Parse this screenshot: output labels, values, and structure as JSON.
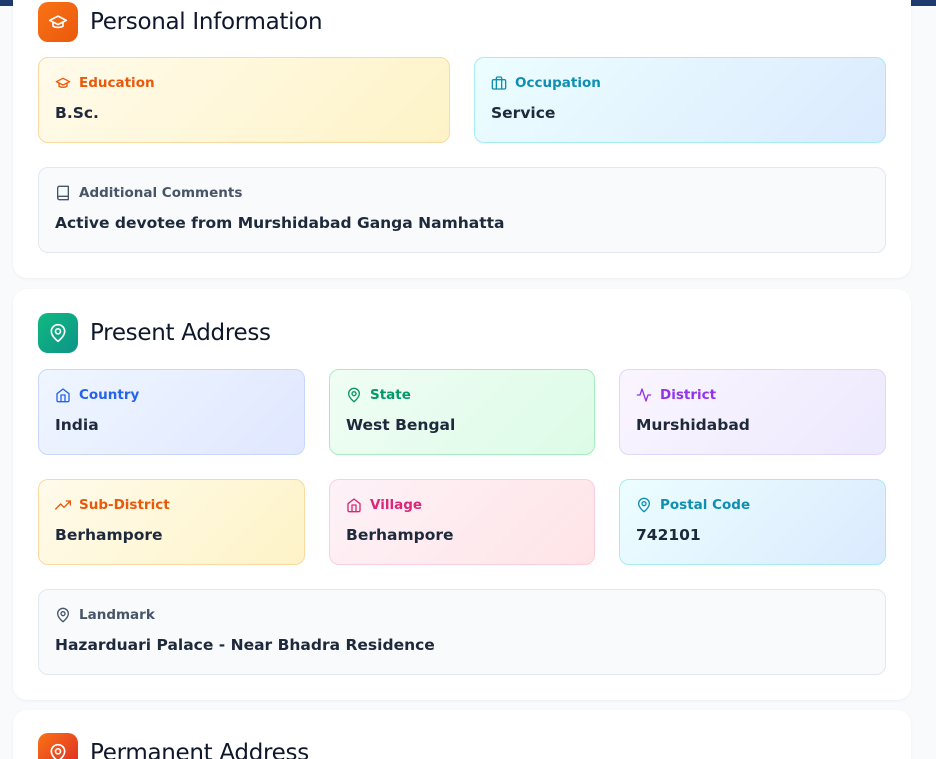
{
  "personal": {
    "title": "Personal Information",
    "education": {
      "label": "Education",
      "value": "B.Sc."
    },
    "occupation": {
      "label": "Occupation",
      "value": "Service"
    },
    "comments": {
      "label": "Additional Comments",
      "value": "Active devotee from Murshidabad Ganga Namhatta"
    }
  },
  "present": {
    "title": "Present Address",
    "country": {
      "label": "Country",
      "value": "India"
    },
    "state": {
      "label": "State",
      "value": "West Bengal"
    },
    "district": {
      "label": "District",
      "value": "Murshidabad"
    },
    "sub_district": {
      "label": "Sub-District",
      "value": "Berhampore"
    },
    "village": {
      "label": "Village",
      "value": "Berhampore"
    },
    "postal_code": {
      "label": "Postal Code",
      "value": "742101"
    },
    "landmark": {
      "label": "Landmark",
      "value": "Hazarduari Palace - Near Bhadra Residence"
    }
  },
  "permanent": {
    "title": "Permanent Address"
  },
  "colors": {
    "personal_icon_bg": "#f97316",
    "present_icon_bg": "#10b981",
    "permanent_icon_bg": "#ea580c",
    "header_bar": "#1e3a6e"
  }
}
